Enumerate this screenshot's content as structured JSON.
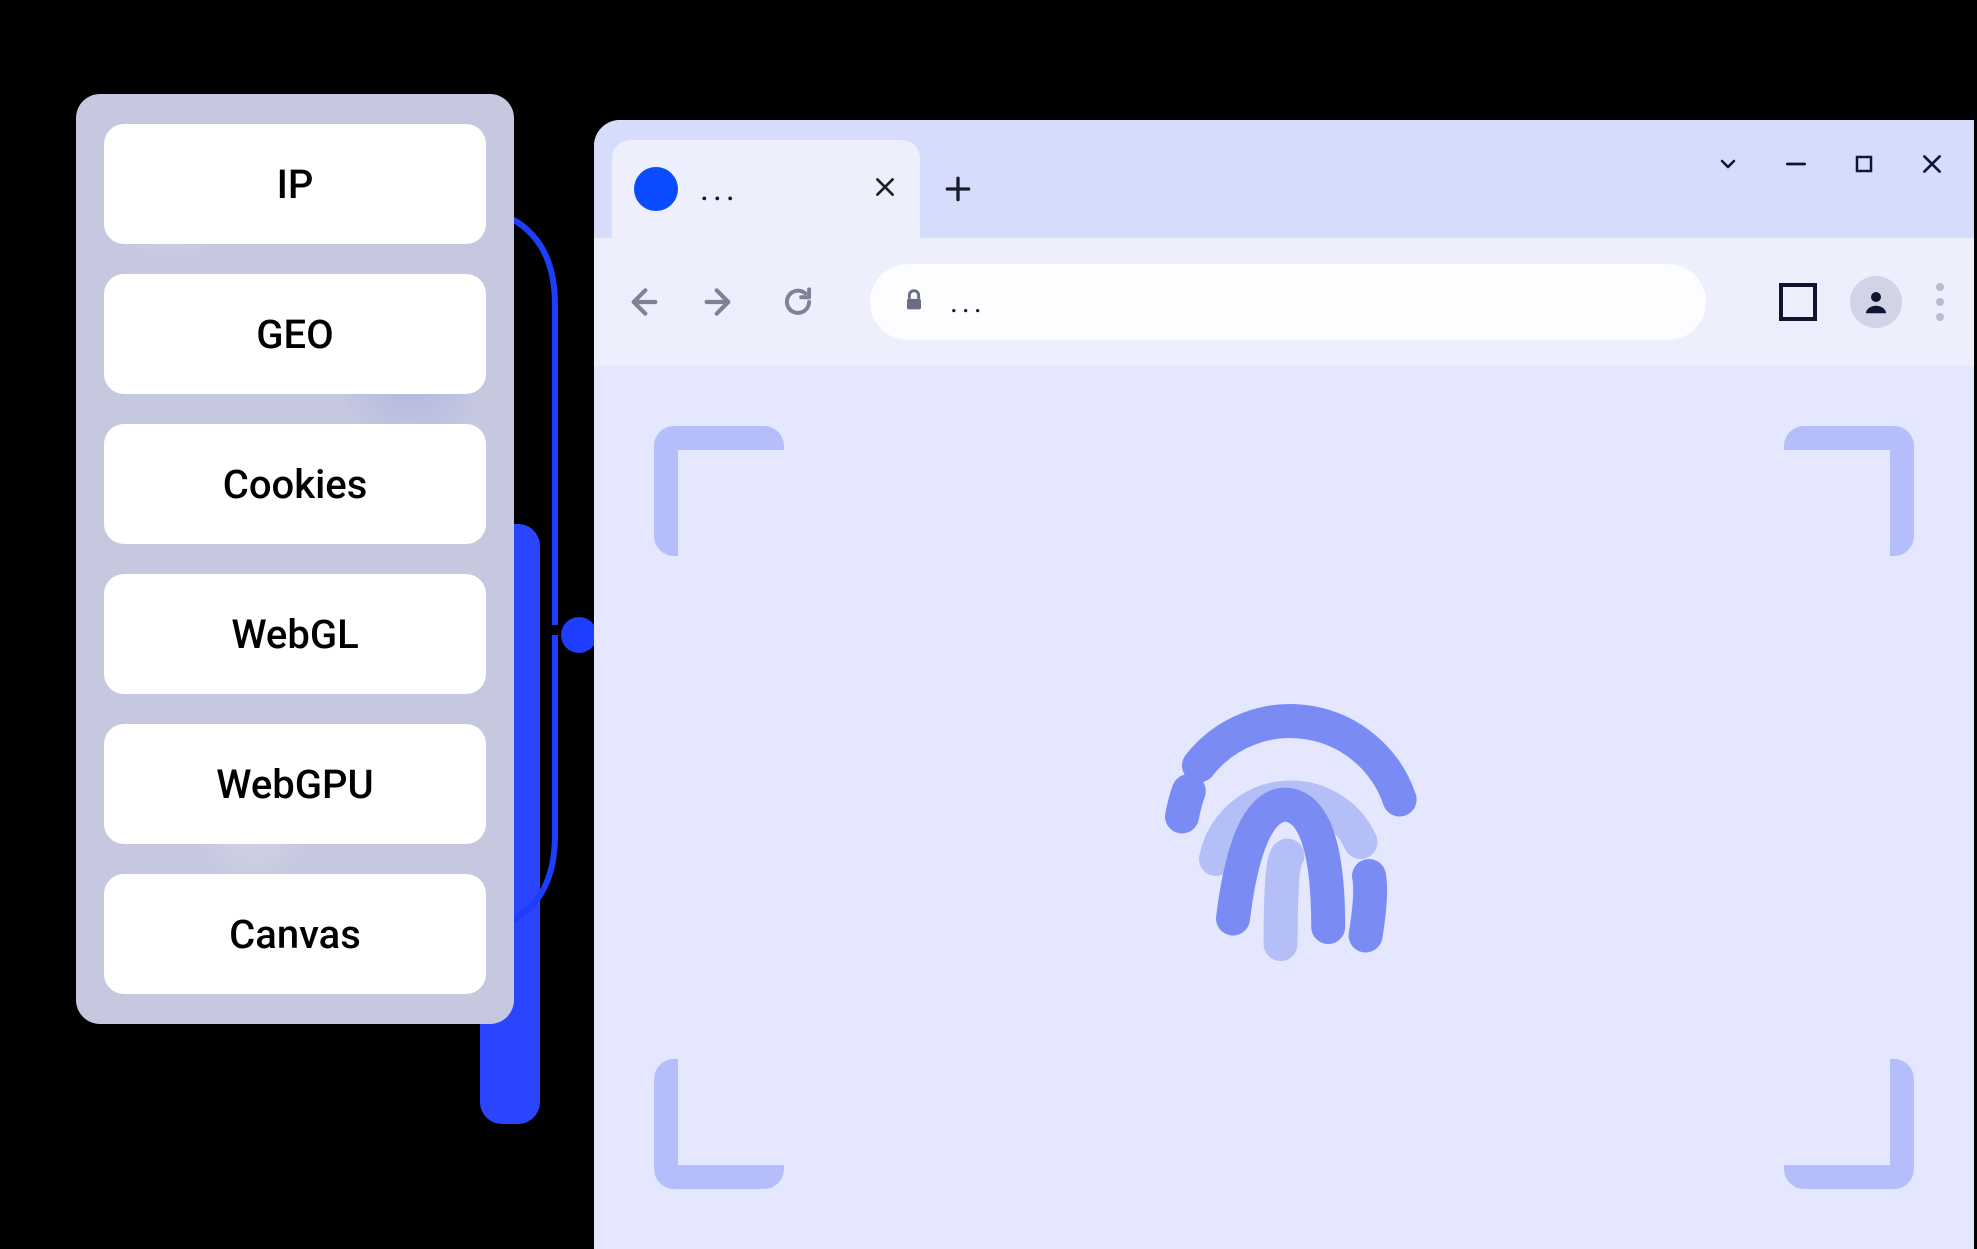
{
  "panel": {
    "items": [
      {
        "label": "IP"
      },
      {
        "label": "GEO"
      },
      {
        "label": "Cookies"
      },
      {
        "label": "WebGL"
      },
      {
        "label": "WebGPU"
      },
      {
        "label": "Canvas"
      }
    ]
  },
  "browser": {
    "tab": {
      "title": "..."
    },
    "address_bar": {
      "url": "..."
    }
  },
  "colors": {
    "accent": "#0a4bff",
    "panel_bg": "#c6c8e0",
    "tab_strip": "#d6dcfc",
    "toolbar": "#edeffd",
    "viewport": "#e4e7fd",
    "scan_frame": "#b4befb",
    "fingerprint_dark": "#7a8cf4",
    "fingerprint_light": "#b4bef7"
  }
}
